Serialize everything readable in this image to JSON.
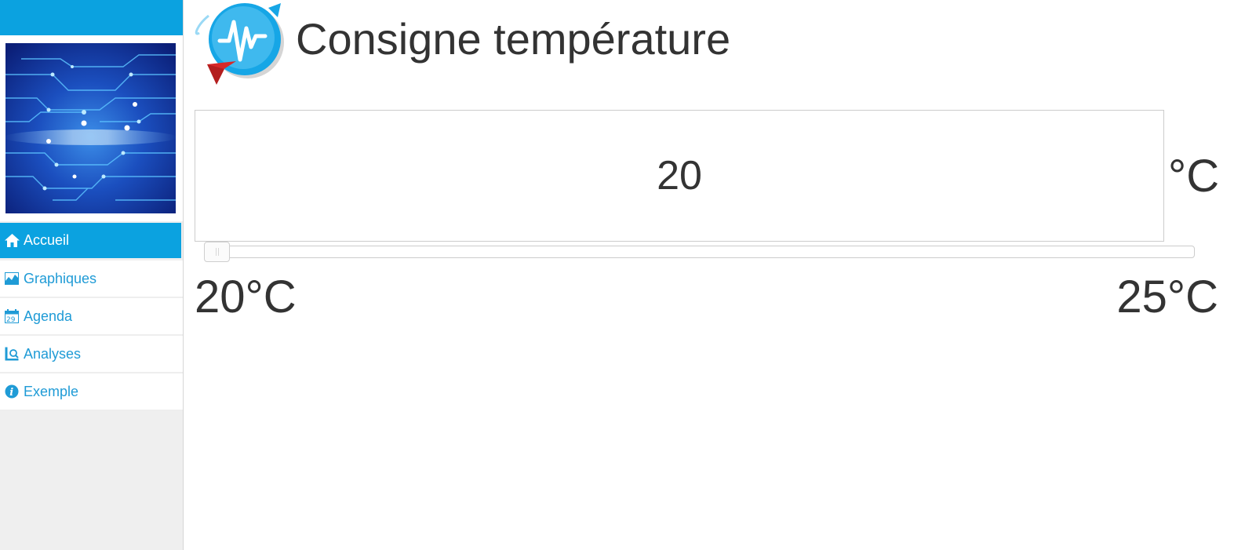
{
  "sidebar": {
    "topbar_color": "#0ba2e0",
    "image": "circuit-board-banner",
    "items": [
      {
        "label": "Accueil",
        "icon": "home-icon",
        "active": true
      },
      {
        "label": "Graphiques",
        "icon": "chart-icon",
        "active": false
      },
      {
        "label": "Agenda",
        "icon": "calendar-icon",
        "active": false
      },
      {
        "label": "Analyses",
        "icon": "analysis-icon",
        "active": false
      },
      {
        "label": "Exemple",
        "icon": "info-icon",
        "active": false
      }
    ]
  },
  "header": {
    "logo": "waveform-logo",
    "title": "Consigne température"
  },
  "setpoint": {
    "value": "20",
    "unit": "°C",
    "slider_value": 20,
    "min_label": "20°C",
    "max_label": "25°C",
    "min": 20,
    "max": 25
  },
  "colors": {
    "accent": "#0ba2e0",
    "link": "#1f9bd6",
    "text": "#333333"
  }
}
